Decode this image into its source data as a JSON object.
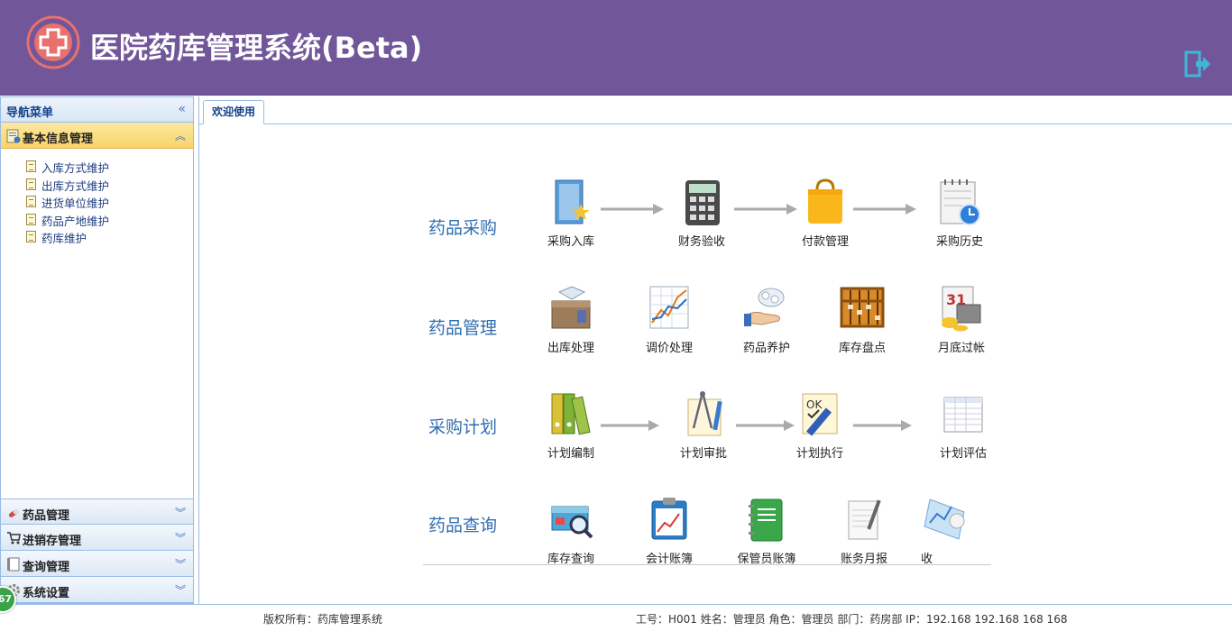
{
  "header": {
    "title": "医院药库管理系统(Beta)",
    "logout_icon": "logout-icon"
  },
  "sidebar": {
    "title": "导航菜单",
    "active_section": {
      "label": "基本信息管理",
      "icon": "info-folder-icon",
      "items": [
        "入库方式维护",
        "出库方式维护",
        "进货单位维护",
        "药品产地维护",
        "药库维护"
      ]
    },
    "sections": [
      {
        "label": "药品管理",
        "icon": "pill-icon"
      },
      {
        "label": "进销存管理",
        "icon": "cart-icon"
      },
      {
        "label": "查询管理",
        "icon": "book-icon"
      },
      {
        "label": "系统设置",
        "icon": "gear-icon"
      }
    ]
  },
  "tabs": [
    {
      "label": "欢迎使用"
    }
  ],
  "workflow": {
    "rows": [
      {
        "label": "药品采购",
        "nodes": [
          "采购入库",
          "财务验收",
          "付款管理",
          "采购历史"
        ]
      },
      {
        "label": "药品管理",
        "nodes": [
          "出库处理",
          "调价处理",
          "药品养护",
          "库存盘点",
          "月底过帐"
        ]
      },
      {
        "label": "采购计划",
        "nodes": [
          "计划编制",
          "计划审批",
          "计划执行",
          "计划评估"
        ]
      },
      {
        "label": "药品查询",
        "nodes": [
          "库存查询",
          "会计账簿",
          "保管员账簿",
          "账务月报",
          "收"
        ]
      }
    ]
  },
  "footer": {
    "copyright": "版权所有：药库管理系统",
    "user_info": "工号：H001 姓名：管理员 角色：管理员 部门：药房部 IP：192.168  192.168 168 168"
  },
  "badge": "67",
  "colors": {
    "header": "#72569a",
    "accent": "#2f6db0",
    "active_section": "#f9d468"
  }
}
